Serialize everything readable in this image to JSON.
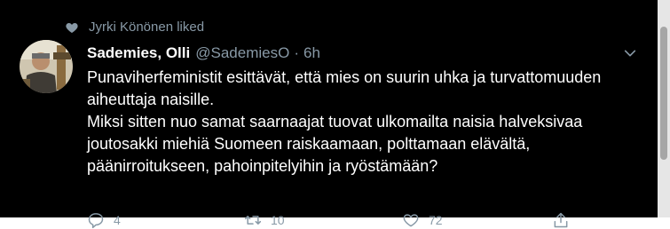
{
  "liked_by": "Jyrki Könönen liked",
  "author": {
    "name": "Sademies, Olli",
    "handle": "@SademiesO",
    "separator": "·",
    "time": "6h"
  },
  "tweet": {
    "paragraphs": [
      "Punaviherfeministit esittävät, että mies on suurin uhka ja turvattomuuden aiheuttaja naisille.",
      "Miksi sitten nuo samat saarnaajat tuovat ulkomailta naisia halveksivaa joutosakki miehiä Suomeen raiskaamaan, polttamaan elävältä, päänirroitukseen, pahoinpitelyihin ja ryöstämään?"
    ]
  },
  "actions": {
    "replies": "4",
    "retweets": "10",
    "likes": "72"
  },
  "icons": [
    "heart-icon",
    "chevron-down-icon",
    "reply-icon",
    "retweet-icon",
    "like-icon",
    "share-icon"
  ],
  "colors": {
    "background": "#000000",
    "text": "#ffffff",
    "muted": "#8899a6"
  }
}
